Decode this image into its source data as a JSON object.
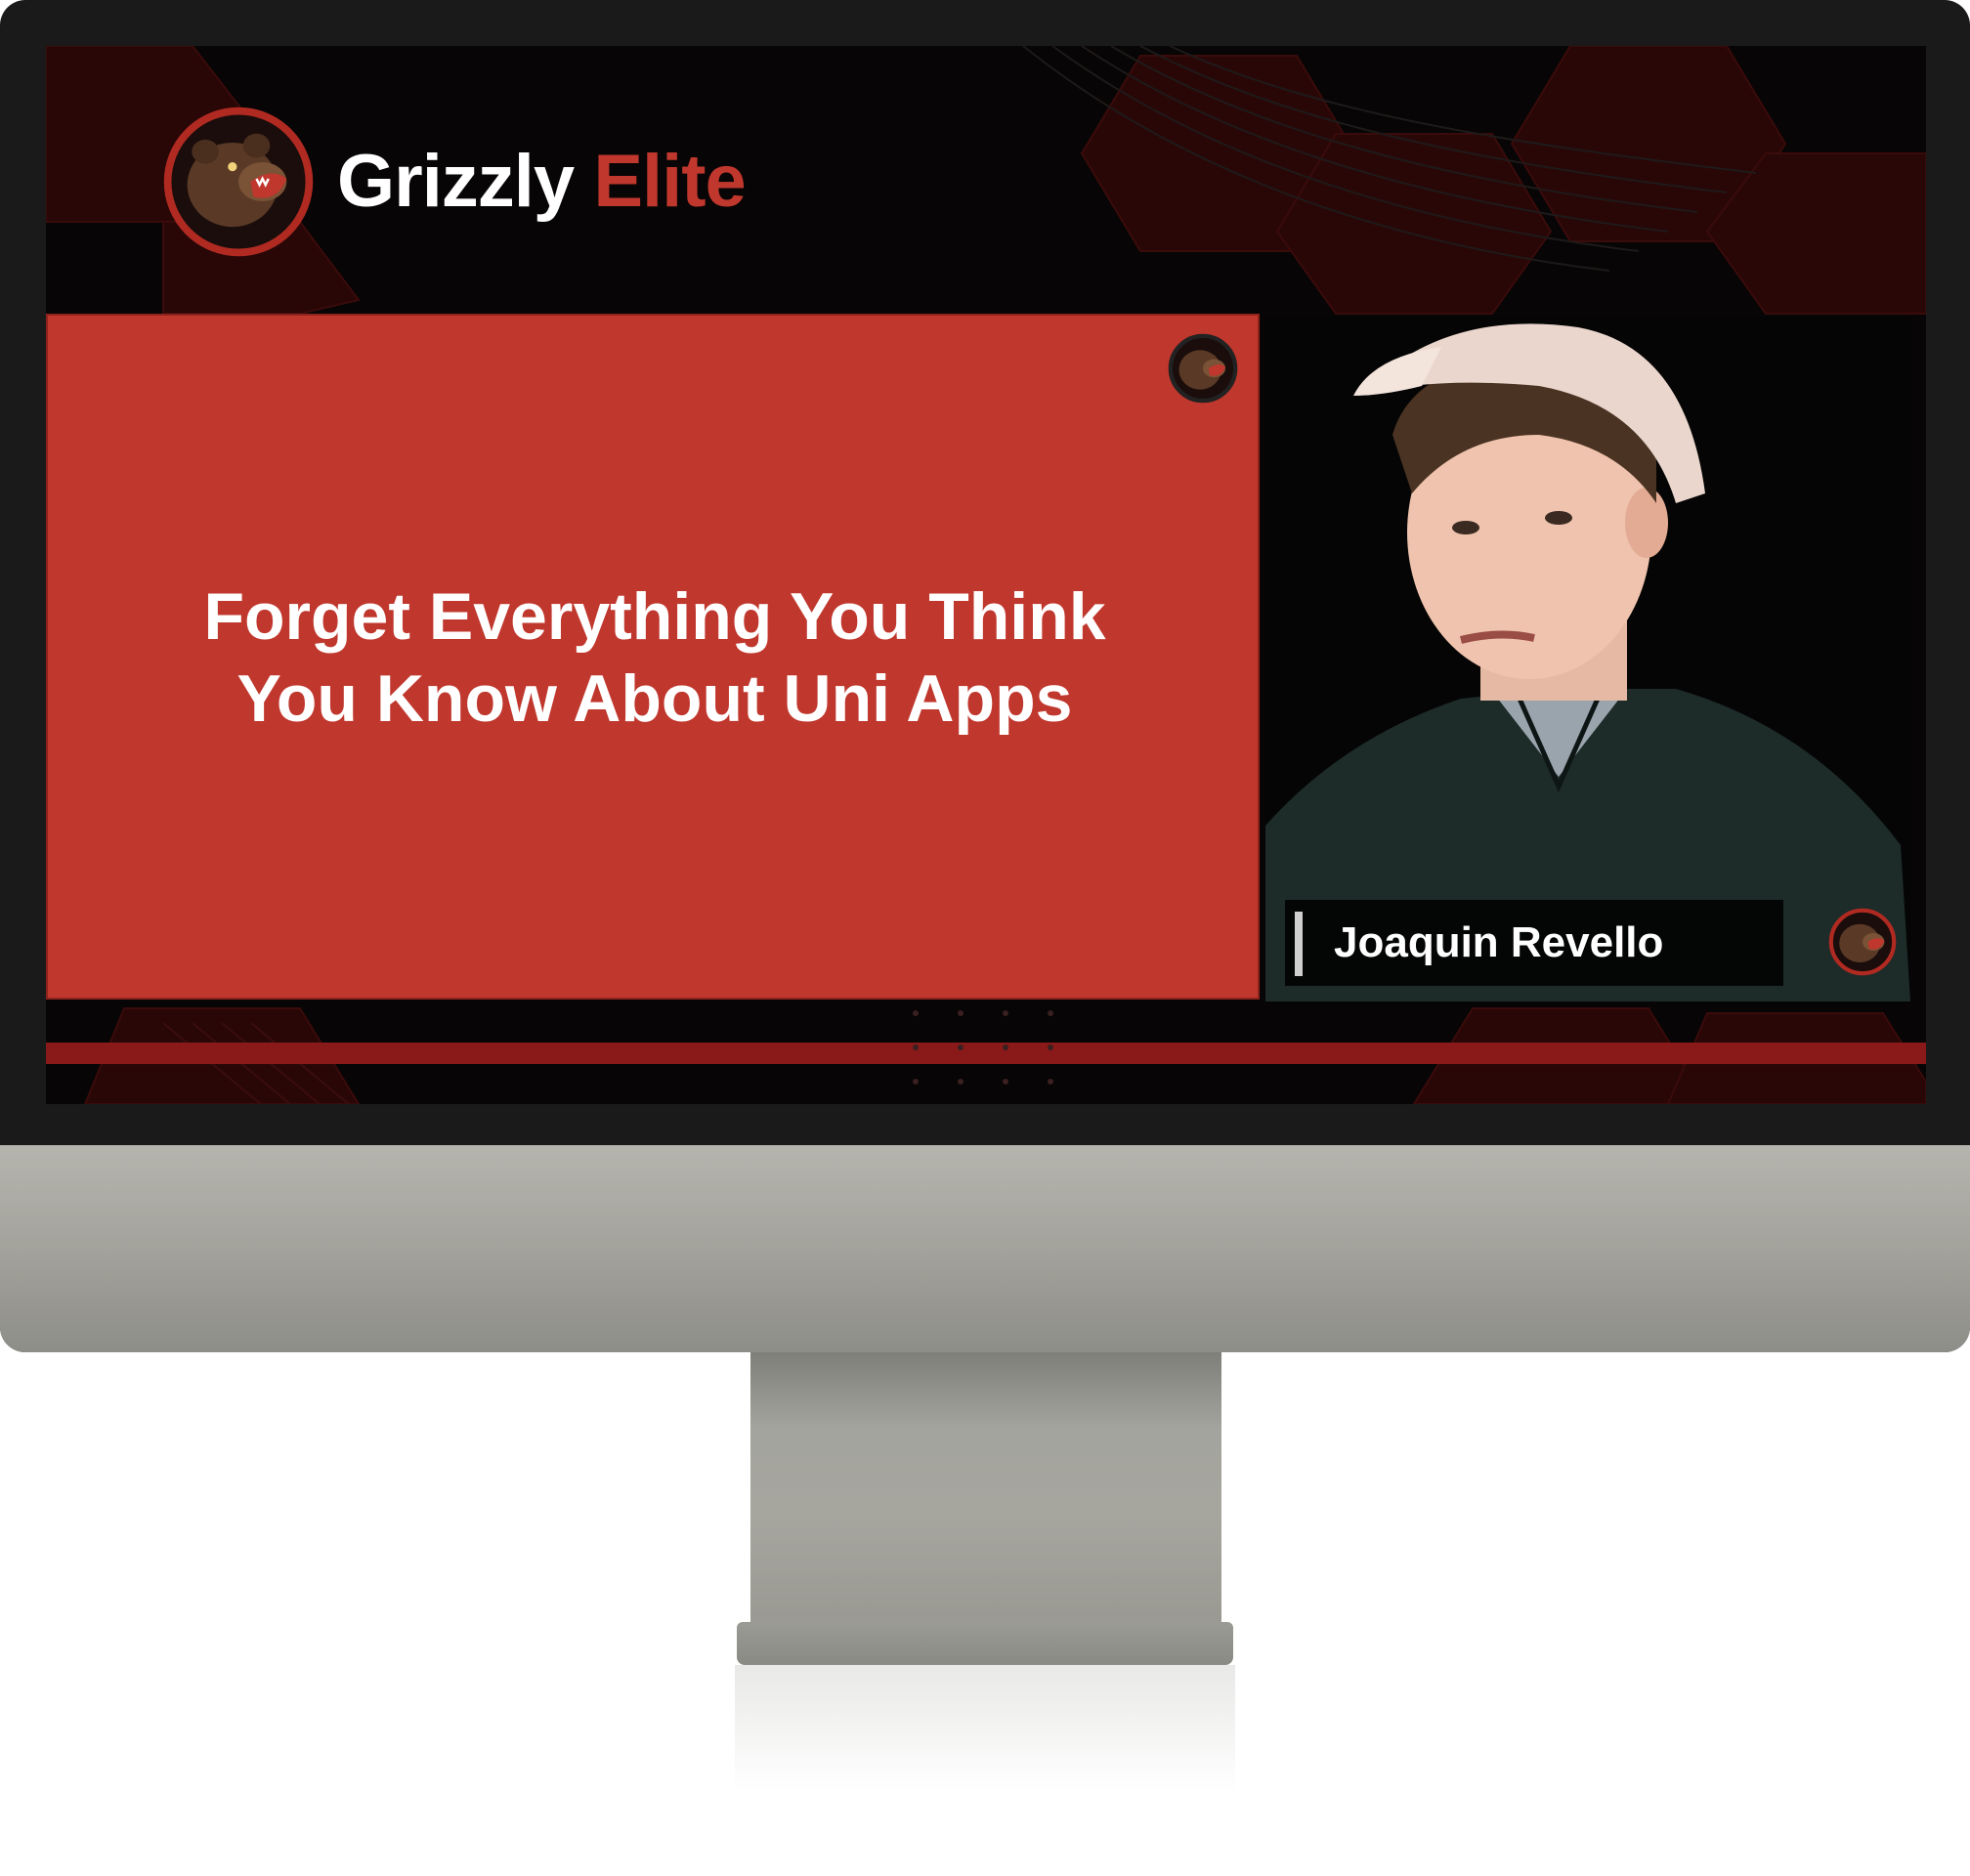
{
  "brand": {
    "name_main": "Grizzly",
    "name_accent": "Elite",
    "logo_icon": "grizzly-bear-logo",
    "accent_color": "#c0372d"
  },
  "slide": {
    "title_line1": "Forget Everything You Think",
    "title_line2": "You Know About Uni Apps",
    "background_color": "#c0372d"
  },
  "camera": {
    "speaker_name": "Joaquin Revello"
  },
  "colors": {
    "screen_background": "#070505",
    "strip": "#8a1a1a",
    "bezel": "#1a1a1a",
    "chassis": "#a3a39c"
  }
}
